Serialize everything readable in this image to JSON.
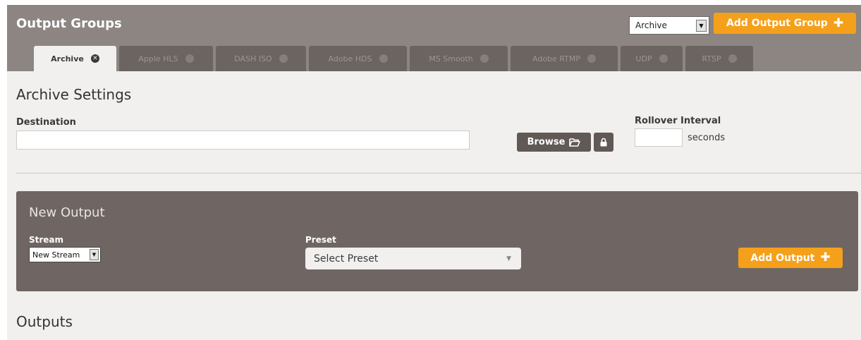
{
  "header": {
    "title": "Output Groups",
    "group_select": {
      "value": "Archive"
    },
    "add_group_label": "Add Output Group"
  },
  "tabs": [
    {
      "label": "Archive",
      "active": true
    },
    {
      "label": "Apple HLS",
      "active": false
    },
    {
      "label": "DASH ISO",
      "active": false
    },
    {
      "label": "Adobe HDS",
      "active": false
    },
    {
      "label": "MS Smooth",
      "active": false
    },
    {
      "label": "Adobe RTMP",
      "active": false
    },
    {
      "label": "UDP",
      "active": false
    },
    {
      "label": "RTSP",
      "active": false
    }
  ],
  "settings": {
    "title": "Archive Settings",
    "destination_label": "Destination",
    "destination_value": "",
    "browse_label": "Browse",
    "rollover_label": "Rollover Interval",
    "rollover_value": "",
    "seconds_label": "seconds"
  },
  "new_output": {
    "title": "New Output",
    "stream_label": "Stream",
    "stream_value": "New Stream",
    "preset_label": "Preset",
    "preset_value": "Select Preset",
    "add_output_label": "Add Output"
  },
  "outputs": {
    "title": "Outputs"
  },
  "icons": {
    "add_group": "plus-icon",
    "add_output": "plus-icon",
    "browse": "folder-open-icon",
    "lock": "lock-icon",
    "tab_close": "close-circle-icon"
  },
  "colors": {
    "accent": "#f5a01a",
    "header_bg": "#8c8581",
    "panel_bg": "#6f6663",
    "tab_inactive": "#6b6461"
  }
}
